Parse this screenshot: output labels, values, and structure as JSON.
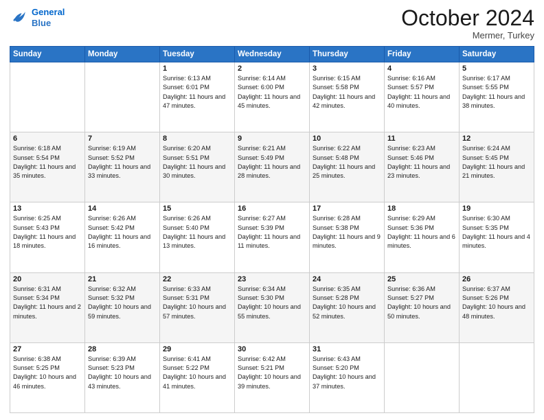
{
  "header": {
    "logo_line1": "General",
    "logo_line2": "Blue",
    "month": "October 2024",
    "location": "Mermer, Turkey"
  },
  "weekdays": [
    "Sunday",
    "Monday",
    "Tuesday",
    "Wednesday",
    "Thursday",
    "Friday",
    "Saturday"
  ],
  "days": [
    {
      "date": "",
      "info": ""
    },
    {
      "date": "",
      "info": ""
    },
    {
      "date": "1",
      "sunrise": "6:13 AM",
      "sunset": "6:01 PM",
      "daylight": "11 hours and 47 minutes."
    },
    {
      "date": "2",
      "sunrise": "6:14 AM",
      "sunset": "6:00 PM",
      "daylight": "11 hours and 45 minutes."
    },
    {
      "date": "3",
      "sunrise": "6:15 AM",
      "sunset": "5:58 PM",
      "daylight": "11 hours and 42 minutes."
    },
    {
      "date": "4",
      "sunrise": "6:16 AM",
      "sunset": "5:57 PM",
      "daylight": "11 hours and 40 minutes."
    },
    {
      "date": "5",
      "sunrise": "6:17 AM",
      "sunset": "5:55 PM",
      "daylight": "11 hours and 38 minutes."
    },
    {
      "date": "6",
      "sunrise": "6:18 AM",
      "sunset": "5:54 PM",
      "daylight": "11 hours and 35 minutes."
    },
    {
      "date": "7",
      "sunrise": "6:19 AM",
      "sunset": "5:52 PM",
      "daylight": "11 hours and 33 minutes."
    },
    {
      "date": "8",
      "sunrise": "6:20 AM",
      "sunset": "5:51 PM",
      "daylight": "11 hours and 30 minutes."
    },
    {
      "date": "9",
      "sunrise": "6:21 AM",
      "sunset": "5:49 PM",
      "daylight": "11 hours and 28 minutes."
    },
    {
      "date": "10",
      "sunrise": "6:22 AM",
      "sunset": "5:48 PM",
      "daylight": "11 hours and 25 minutes."
    },
    {
      "date": "11",
      "sunrise": "6:23 AM",
      "sunset": "5:46 PM",
      "daylight": "11 hours and 23 minutes."
    },
    {
      "date": "12",
      "sunrise": "6:24 AM",
      "sunset": "5:45 PM",
      "daylight": "11 hours and 21 minutes."
    },
    {
      "date": "13",
      "sunrise": "6:25 AM",
      "sunset": "5:43 PM",
      "daylight": "11 hours and 18 minutes."
    },
    {
      "date": "14",
      "sunrise": "6:26 AM",
      "sunset": "5:42 PM",
      "daylight": "11 hours and 16 minutes."
    },
    {
      "date": "15",
      "sunrise": "6:26 AM",
      "sunset": "5:40 PM",
      "daylight": "11 hours and 13 minutes."
    },
    {
      "date": "16",
      "sunrise": "6:27 AM",
      "sunset": "5:39 PM",
      "daylight": "11 hours and 11 minutes."
    },
    {
      "date": "17",
      "sunrise": "6:28 AM",
      "sunset": "5:38 PM",
      "daylight": "11 hours and 9 minutes."
    },
    {
      "date": "18",
      "sunrise": "6:29 AM",
      "sunset": "5:36 PM",
      "daylight": "11 hours and 6 minutes."
    },
    {
      "date": "19",
      "sunrise": "6:30 AM",
      "sunset": "5:35 PM",
      "daylight": "11 hours and 4 minutes."
    },
    {
      "date": "20",
      "sunrise": "6:31 AM",
      "sunset": "5:34 PM",
      "daylight": "11 hours and 2 minutes."
    },
    {
      "date": "21",
      "sunrise": "6:32 AM",
      "sunset": "5:32 PM",
      "daylight": "10 hours and 59 minutes."
    },
    {
      "date": "22",
      "sunrise": "6:33 AM",
      "sunset": "5:31 PM",
      "daylight": "10 hours and 57 minutes."
    },
    {
      "date": "23",
      "sunrise": "6:34 AM",
      "sunset": "5:30 PM",
      "daylight": "10 hours and 55 minutes."
    },
    {
      "date": "24",
      "sunrise": "6:35 AM",
      "sunset": "5:28 PM",
      "daylight": "10 hours and 52 minutes."
    },
    {
      "date": "25",
      "sunrise": "6:36 AM",
      "sunset": "5:27 PM",
      "daylight": "10 hours and 50 minutes."
    },
    {
      "date": "26",
      "sunrise": "6:37 AM",
      "sunset": "5:26 PM",
      "daylight": "10 hours and 48 minutes."
    },
    {
      "date": "27",
      "sunrise": "6:38 AM",
      "sunset": "5:25 PM",
      "daylight": "10 hours and 46 minutes."
    },
    {
      "date": "28",
      "sunrise": "6:39 AM",
      "sunset": "5:23 PM",
      "daylight": "10 hours and 43 minutes."
    },
    {
      "date": "29",
      "sunrise": "6:41 AM",
      "sunset": "5:22 PM",
      "daylight": "10 hours and 41 minutes."
    },
    {
      "date": "30",
      "sunrise": "6:42 AM",
      "sunset": "5:21 PM",
      "daylight": "10 hours and 39 minutes."
    },
    {
      "date": "31",
      "sunrise": "6:43 AM",
      "sunset": "5:20 PM",
      "daylight": "10 hours and 37 minutes."
    },
    {
      "date": "",
      "info": ""
    },
    {
      "date": "",
      "info": ""
    },
    {
      "date": "",
      "info": ""
    }
  ],
  "labels": {
    "sunrise": "Sunrise:",
    "sunset": "Sunset:",
    "daylight": "Daylight:"
  }
}
